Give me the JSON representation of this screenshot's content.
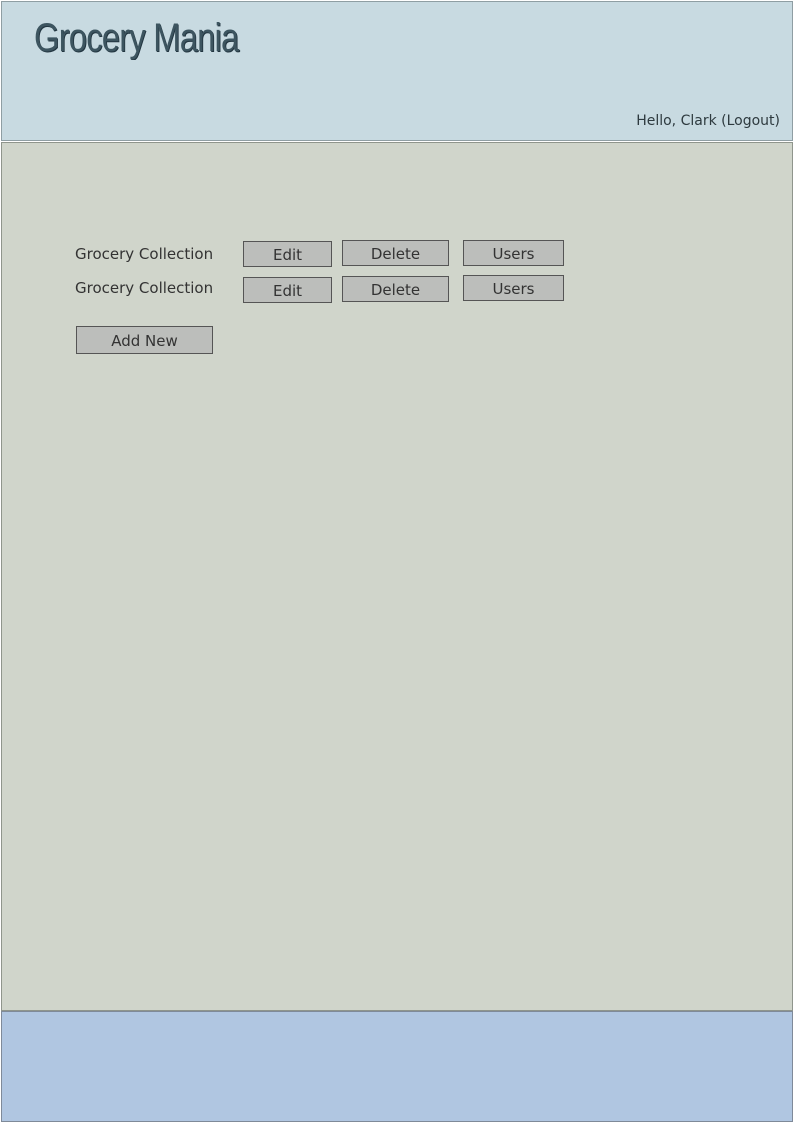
{
  "header": {
    "app_title": "Grocery Mania",
    "greeting": "Hello, Clark",
    "logout_label": "(Logout)"
  },
  "collections": [
    {
      "name": "Grocery Collection",
      "edit_label": "Edit",
      "delete_label": "Delete",
      "users_label": "Users"
    },
    {
      "name": "Grocery Collection",
      "edit_label": "Edit",
      "delete_label": "Delete",
      "users_label": "Users"
    }
  ],
  "actions": {
    "add_new_label": "Add New"
  },
  "colors": {
    "header_bg": "#c8dae1",
    "main_bg": "#d0d5cb",
    "footer_bg": "#b0c6e1",
    "button_bg": "#bcbebb"
  }
}
